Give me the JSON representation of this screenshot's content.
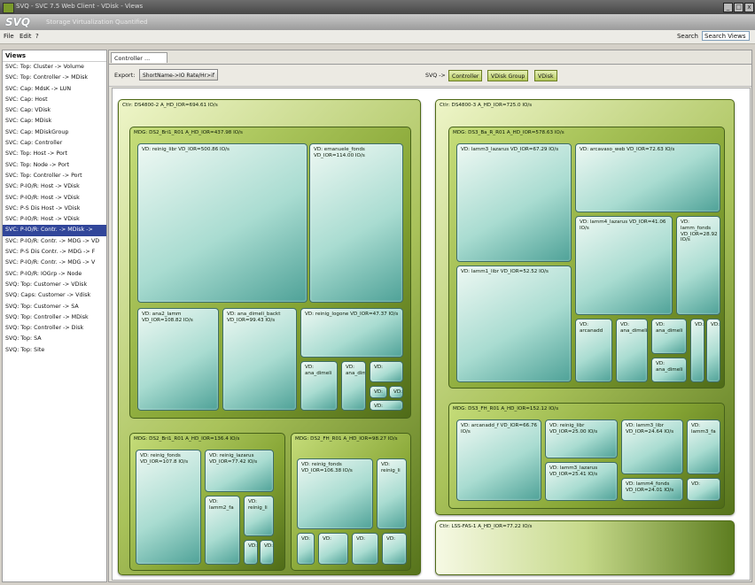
{
  "window": {
    "title": "SVQ - SVC 7.5 Web Client - VDisk - Views",
    "buttons": [
      "_",
      "□",
      "x"
    ]
  },
  "banner": {
    "logo": "SVQ",
    "tagline": "Storage Virtualization Quantified"
  },
  "menu": {
    "items": [
      "File",
      "Edit",
      "?"
    ],
    "search_label": "Search",
    "search_value": "Search Views"
  },
  "views": {
    "header": "Views",
    "items": [
      "SVC: Top: Cluster -> Volume",
      "SVC: Top: Controller -> MDisk",
      "SVC: Cap: MdsK -> LUN",
      "SVC: Cap: Host",
      "SVC: Cap: VDisk",
      "SVC: Cap: MDisk",
      "SVC: Cap: MDiskGroup",
      "SVC: Cap: Controller",
      "SVC: Top: Host -> Port",
      "SVC: Top: Node -> Port",
      "SVC: Top: Controller -> Port",
      "SVC: P-IO/R: Host -> VDisk",
      "SVC: P-IO/R: Host -> VDisk",
      "SVC: P-S Dis Host -> VDisk",
      "SVC: P-IO/R: Host -> VDisk",
      "SVC: P-IO/R: Contr. -> MDisk ->",
      "SVC: P-IO/R: Contr. -> MDG -> VD",
      "SVC: P-S Dis Contr. -> MDG -> F",
      "SVC: P-IO/R: Contr. -> MDG -> V",
      "SVC: P-IO/R: IOGrp -> Node",
      "SVQ: Top: Customer -> VDisk",
      "SVQ: Caps: Customer -> Vdisk",
      "SVQ: Top: Customer -> SA",
      "SVQ: Top: Controller -> MDisk",
      "SVQ: Top: Controller -> Disk",
      "SVQ: Top: SA",
      "SVQ: Top: Site"
    ],
    "selected_index": 15
  },
  "tab": {
    "label": "Controller ... VDisk"
  },
  "toolbar": {
    "export_label": "Export:",
    "export_button": "ShortName->IO Rate/Hr>if",
    "breadcrumb_label": "SVQ ->",
    "breadcrumb": [
      "Controller",
      "VDisk Group",
      "VDisk"
    ]
  },
  "treemap": {
    "controllers": [
      {
        "label": "Ctlr: DS4800-2 A_HD_IOR=694.61 IO/s",
        "groups": [
          {
            "label": "MDG: DS2_Bri1_R01 A_HD_IOR=437.98 IO/s",
            "vdisks": [
              "VD: reinig_libr VD_IOR=500.86 IO/s",
              "VD: emanuele_fonds VD_IOR=114.00 IO/s",
              "VD: ana2_lamm VD_IOR=108.82 IO/s",
              "VD: ana_dimeli_backt VD_IOR=99.43 IO/s",
              "VD: reinig_logone VD_IOR=47.37 IO/s",
              "VD: ana_dimeli",
              "VD: ana_dimeli",
              "VD:",
              "VD:",
              "VD:",
              "VD:"
            ]
          },
          {
            "label": "MDG: DS2_Bri1_R01 A_HD_IOR=136.4 IO/s",
            "vdisks": [
              "VD: reinig_fonds VD_IOR=107.8 IO/s",
              "VD: reinig_lazarus VD_IOR=77.42 IO/s",
              "VD: lamm2_fa",
              "VD: reinig_li",
              "VD:",
              "VD:"
            ]
          },
          {
            "label": "MDG: DS2_FH_R01 A_HD_IOR=98.27 IO/s",
            "vdisks": [
              "VD: reinig_fonds VD_IOR=106.38 IO/s",
              "VD: reinig_li",
              "VD:",
              "VD:",
              "VD:",
              "VD:"
            ]
          }
        ]
      },
      {
        "label": "Ctlr: DS4800-3 A_HD_IOR=725.0 IO/s",
        "groups": [
          {
            "label": "MDG: DS3_Ba_R_R01 A_HD_IOR=578.63 IO/s",
            "vdisks": [
              "VD: lamm3_lazarus VD_IOR=67.29 IO/s",
              "VD: arcavaso_web VD_IOR=72.63 IO/s",
              "VD: lamm1_libr VD_IOR=52.52 IO/s",
              "VD: lamm4_lazarus VD_IOR=41.06 IO/s",
              "VD: lamm_fonds VD_IOR=28.92 IO/s",
              "VD: arcanadd",
              "VD: ana_dimeli",
              "VD: ana_dimeli",
              "VD: ana_dimeli",
              "VD:",
              "VD:"
            ]
          },
          {
            "label": "MDG: DS3_FH_R01 A_HD_IOR=152.12 IO/s",
            "vdisks": [
              "VD: arcanadd_f VD_IOR=66.76 IO/s",
              "VD: reinig_libr VD_IOR=25.00 IO/s",
              "VD: lamm3_libr VD_IOR=24.64 IO/s",
              "VD: lamm3_lazarus VD_IOR=25.41 IO/s",
              "VD: lamm4_fonds VD_IOR=24.01 IO/s",
              "VD: lamm3_fa",
              "VD:"
            ]
          }
        ]
      },
      {
        "label": "Ctlr: LSS-FAS-1 A_HD_IOR=77.22 IO/s",
        "groups": []
      }
    ]
  },
  "colors": {
    "controller": "#8fae3e",
    "mdisk_group": "#7d9c2c",
    "vdisk": "#7cc6ba",
    "selection": "#31469a"
  }
}
